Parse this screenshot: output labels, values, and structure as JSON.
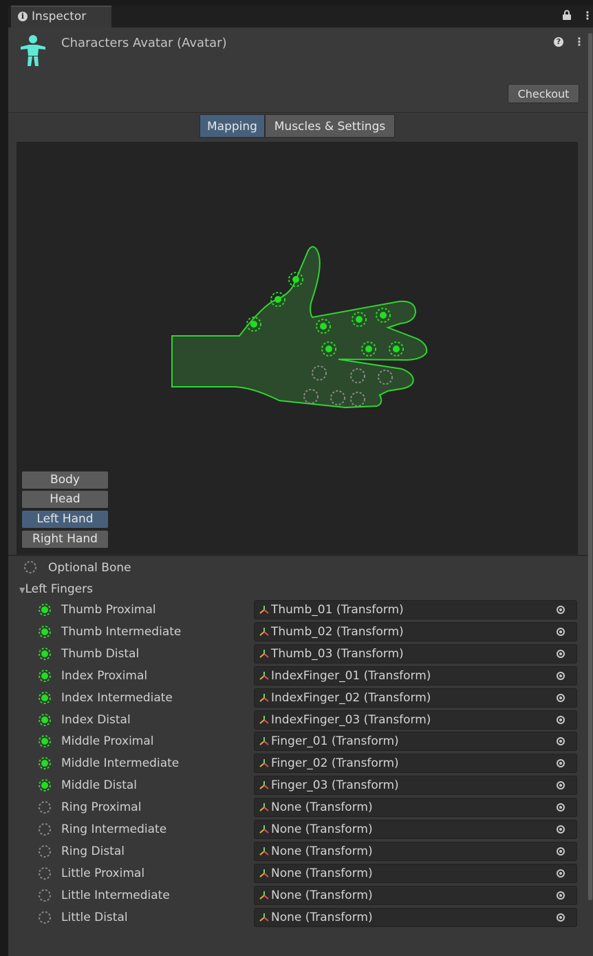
{
  "window": {
    "tab_title": "Inspector"
  },
  "header": {
    "title": "Characters Avatar (Avatar)",
    "checkout_label": "Checkout"
  },
  "tabs": [
    {
      "label": "Mapping",
      "active": true
    },
    {
      "label": "Muscles & Settings",
      "active": false
    }
  ],
  "body_parts": [
    {
      "label": "Body",
      "selected": false
    },
    {
      "label": "Head",
      "selected": false
    },
    {
      "label": "Left Hand",
      "selected": true
    },
    {
      "label": "Right Hand",
      "selected": false
    }
  ],
  "legend": {
    "optional_bone_label": "Optional Bone"
  },
  "section": {
    "title": "Left Fingers"
  },
  "bones": [
    {
      "name": "Thumb Proximal",
      "value": "Thumb_01 (Transform)",
      "assigned": true
    },
    {
      "name": "Thumb Intermediate",
      "value": "Thumb_02 (Transform)",
      "assigned": true
    },
    {
      "name": "Thumb Distal",
      "value": "Thumb_03 (Transform)",
      "assigned": true
    },
    {
      "name": "Index Proximal",
      "value": "IndexFinger_01 (Transform)",
      "assigned": true
    },
    {
      "name": "Index Intermediate",
      "value": "IndexFinger_02 (Transform)",
      "assigned": true
    },
    {
      "name": "Index Distal",
      "value": "IndexFinger_03 (Transform)",
      "assigned": true
    },
    {
      "name": "Middle Proximal",
      "value": "Finger_01 (Transform)",
      "assigned": true
    },
    {
      "name": "Middle Intermediate",
      "value": "Finger_02 (Transform)",
      "assigned": true
    },
    {
      "name": "Middle Distal",
      "value": "Finger_03 (Transform)",
      "assigned": true
    },
    {
      "name": "Ring Proximal",
      "value": "None (Transform)",
      "assigned": false
    },
    {
      "name": "Ring Intermediate",
      "value": "None (Transform)",
      "assigned": false
    },
    {
      "name": "Ring Distal",
      "value": "None (Transform)",
      "assigned": false
    },
    {
      "name": "Little Proximal",
      "value": "None (Transform)",
      "assigned": false
    },
    {
      "name": "Little Intermediate",
      "value": "None (Transform)",
      "assigned": false
    },
    {
      "name": "Little Distal",
      "value": "None (Transform)",
      "assigned": false
    }
  ],
  "colors": {
    "assigned": "#22dd22",
    "unassigned": "#8a8a8a",
    "hand_outline": "#2fd52f",
    "hand_fill": "#2c4a2c",
    "accent": "#46607c"
  }
}
